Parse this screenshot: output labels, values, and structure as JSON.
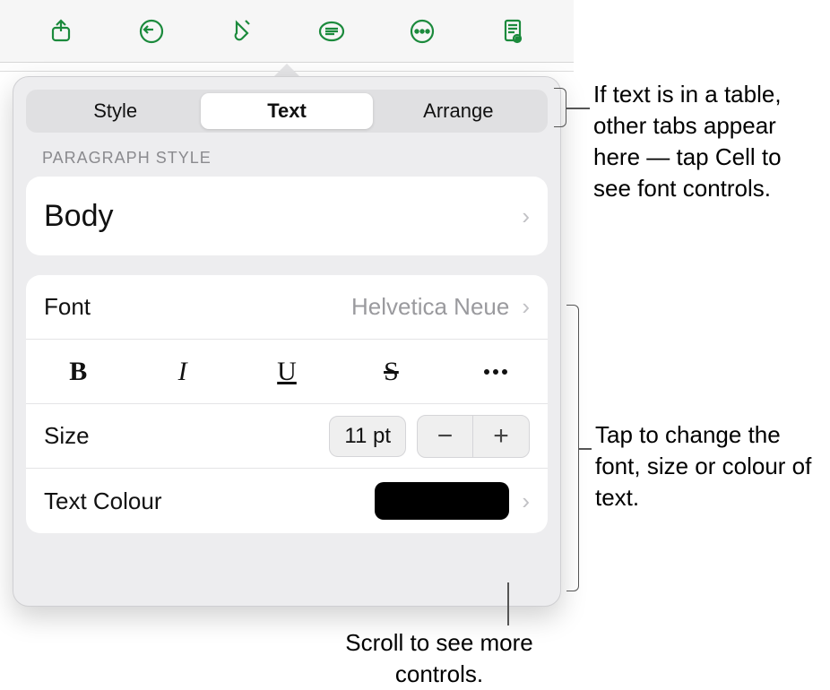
{
  "tabs": {
    "style": "Style",
    "text": "Text",
    "arrange": "Arrange",
    "selected": "text"
  },
  "paragraph": {
    "section_label": "Paragraph Style",
    "value": "Body"
  },
  "font": {
    "label": "Font",
    "value": "Helvetica Neue"
  },
  "size": {
    "label": "Size",
    "value": "11 pt"
  },
  "text_colour": {
    "label": "Text Colour",
    "swatch": "#000000"
  },
  "callouts": {
    "tabs": "If text is in a table, other tabs appear here — tap Cell to see font controls.",
    "font_group": "Tap to change the font, size or colour of text.",
    "scroll": "Scroll to see more controls."
  }
}
